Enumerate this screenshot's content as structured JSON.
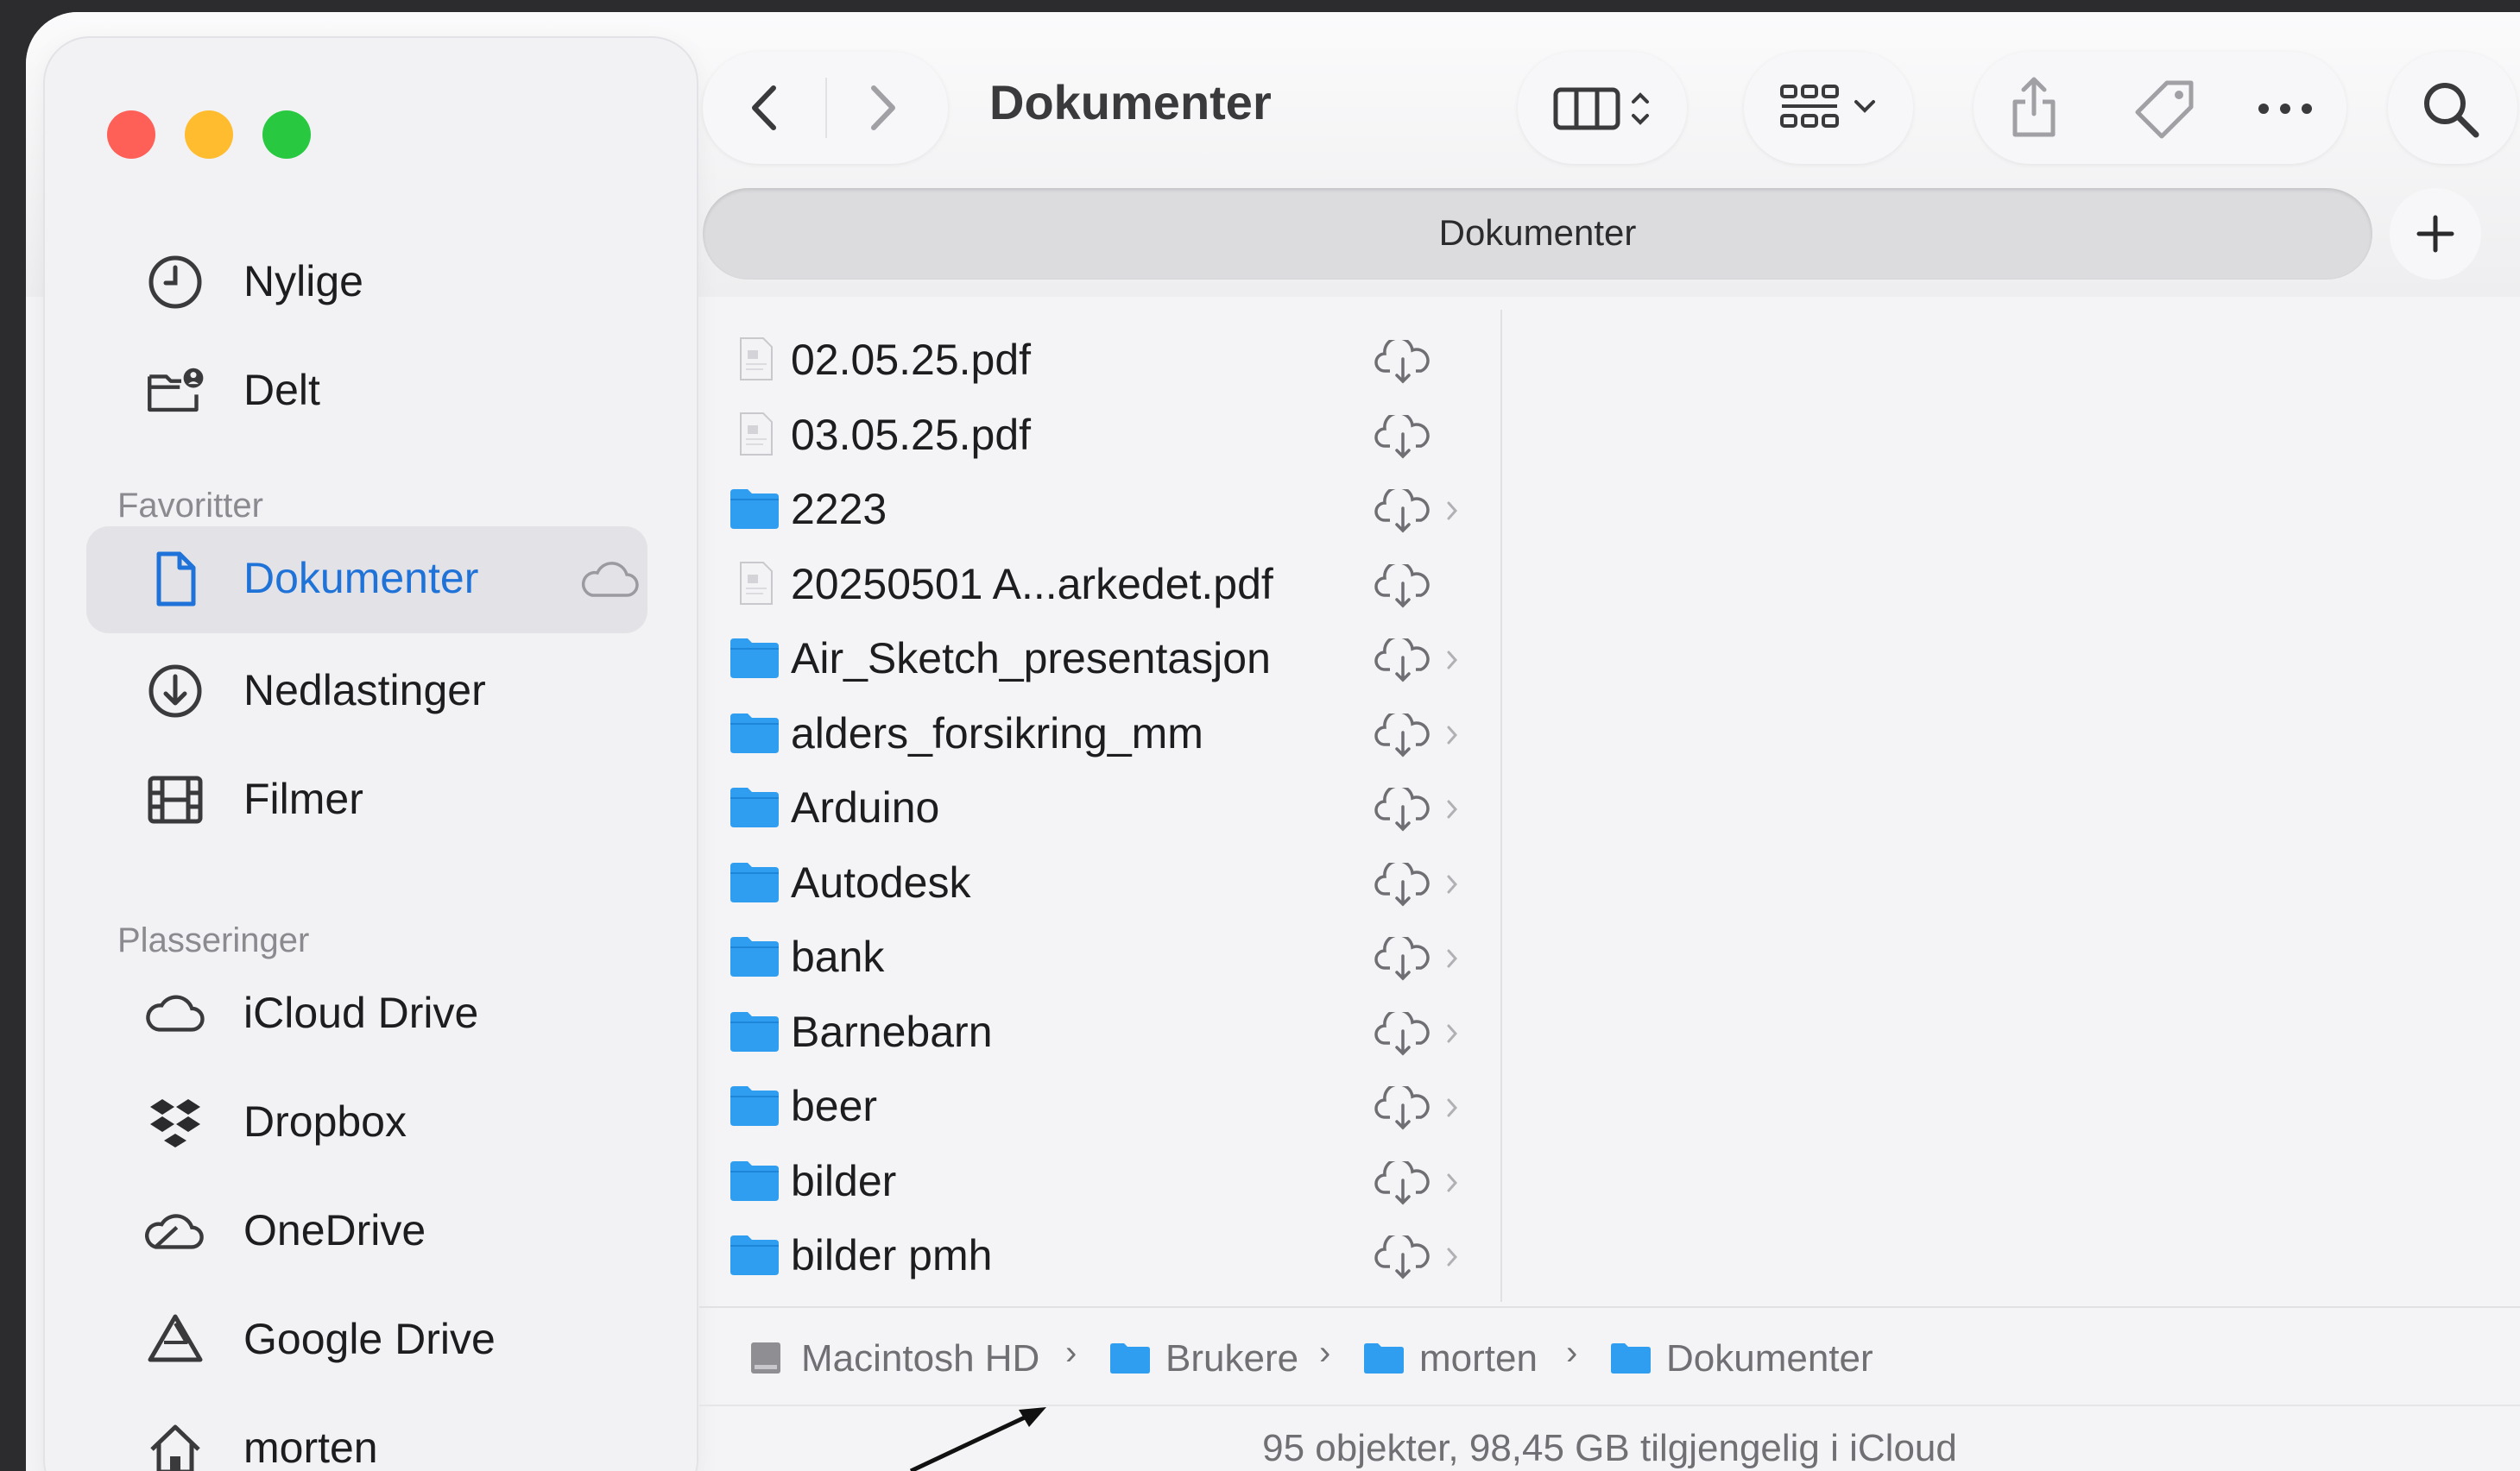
{
  "window": {
    "title": "Dokumenter",
    "tab_label": "Dokumenter",
    "traffic_lights": {
      "close": "#fe5f57",
      "minimize": "#febc2e",
      "zoom": "#28c840"
    }
  },
  "toolbar": {
    "back_icon": "chevron-left-icon",
    "forward_icon": "chevron-right-icon",
    "view_icon": "column-view-icon",
    "group_icon": "grid-group-icon",
    "share_icon": "share-icon",
    "tag_icon": "tag-icon",
    "more_icon": "ellipsis-icon",
    "search_icon": "search-icon",
    "new_tab_icon": "plus-icon"
  },
  "sidebar": {
    "top_items": [
      {
        "label": "Nylige",
        "icon": "clock-icon"
      },
      {
        "label": "Delt",
        "icon": "shared-folder-icon"
      }
    ],
    "favorites_header": "Favoritter",
    "favorites": [
      {
        "label": "Dokumenter",
        "icon": "document-icon",
        "active": true
      },
      {
        "label": "Nedlastinger",
        "icon": "download-icon"
      },
      {
        "label": "Filmer",
        "icon": "film-icon"
      }
    ],
    "locations_header": "Plasseringer",
    "locations": [
      {
        "label": "iCloud Drive",
        "icon": "cloud-icon"
      },
      {
        "label": "Dropbox",
        "icon": "dropbox-icon"
      },
      {
        "label": "OneDrive",
        "icon": "onedrive-icon"
      },
      {
        "label": "Google Drive",
        "icon": "google-drive-icon"
      },
      {
        "label": "morten",
        "icon": "home-icon"
      }
    ]
  },
  "files": [
    {
      "name": "02.05.25.pdf",
      "kind": "pdf"
    },
    {
      "name": "03.05.25.pdf",
      "kind": "pdf"
    },
    {
      "name": "2223",
      "kind": "folder"
    },
    {
      "name": "20250501 A...arkedet.pdf",
      "kind": "pdf"
    },
    {
      "name": "Air_Sketch_presentasjon",
      "kind": "folder"
    },
    {
      "name": "alders_forsikring_mm",
      "kind": "folder"
    },
    {
      "name": "Arduino",
      "kind": "folder"
    },
    {
      "name": "Autodesk",
      "kind": "folder"
    },
    {
      "name": "bank",
      "kind": "folder"
    },
    {
      "name": "Barnebarn",
      "kind": "folder"
    },
    {
      "name": "beer",
      "kind": "folder"
    },
    {
      "name": "bilder",
      "kind": "folder"
    },
    {
      "name": "bilder pmh",
      "kind": "folder"
    }
  ],
  "path": [
    {
      "label": "Macintosh HD",
      "icon": "disk-icon"
    },
    {
      "label": "Brukere",
      "icon": "folder-icon"
    },
    {
      "label": "morten",
      "icon": "folder-icon"
    },
    {
      "label": "Dokumenter",
      "icon": "folder-icon"
    }
  ],
  "path_separator": "›",
  "status": "95 objekter, 98,45 GB tilgjengelig i iCloud",
  "colors": {
    "accent": "#1e72d8",
    "folder": "#2f9ef0"
  }
}
